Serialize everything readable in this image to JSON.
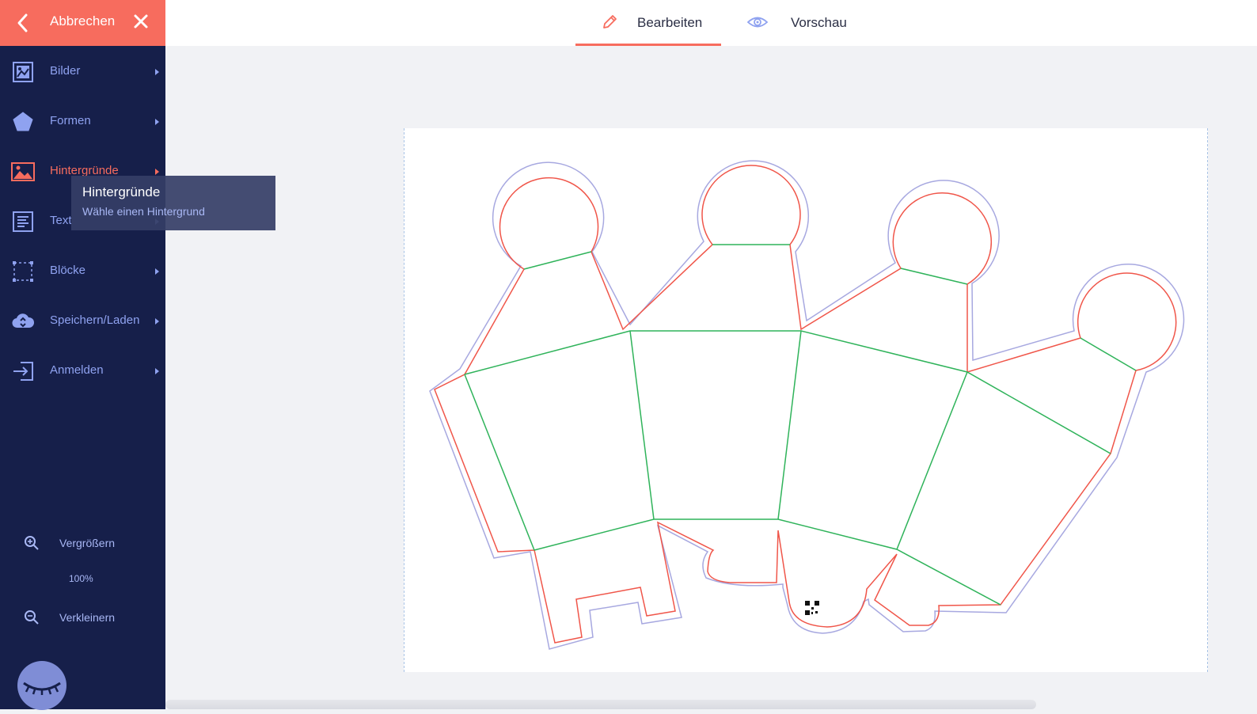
{
  "sidebar": {
    "cancel_label": "Abbrechen",
    "items": [
      {
        "label": "Bilder",
        "icon": "image-frame-icon"
      },
      {
        "label": "Formen",
        "icon": "pentagon-icon"
      },
      {
        "label": "Hintergründe",
        "icon": "landscape-icon"
      },
      {
        "label": "Text",
        "icon": "text-lines-icon"
      },
      {
        "label": "Blöcke",
        "icon": "block-select-icon"
      },
      {
        "label": "Speichern/Laden",
        "icon": "cloud-sync-icon"
      },
      {
        "label": "Anmelden",
        "icon": "login-arrow-icon"
      }
    ],
    "active_item": "Hintergründe",
    "tooltip": {
      "title": "Hintergründe",
      "subtitle": "Wähle einen Hintergrund"
    },
    "zoom_in_label": "Vergrößern",
    "zoom_level": "100%",
    "zoom_out_label": "Verkleinern"
  },
  "topbar": {
    "tabs": [
      {
        "label": "Bearbeiten",
        "icon": "pencil-icon",
        "active": true
      },
      {
        "label": "Vorschau",
        "icon": "eye-icon",
        "active": false
      }
    ]
  },
  "colors": {
    "accent": "#f76c5e",
    "sidebar_bg": "#161f4a",
    "sidebar_text": "#8fa2f0",
    "cut_line": "#f0564a",
    "fold_line": "#2fb35a",
    "bleed_line": "#a7a8e0"
  }
}
